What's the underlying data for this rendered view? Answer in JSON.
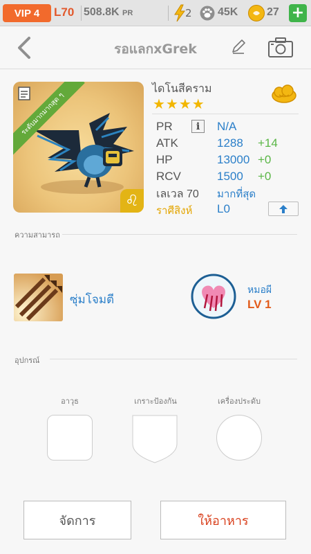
{
  "topbar": {
    "vip": "VIP 4",
    "level": "L70",
    "power": "508.8K",
    "power_unit": "PR",
    "energy": "2",
    "paw_count": "45K",
    "coins": "27",
    "add_label": "+"
  },
  "header": {
    "title": "รอแลกxGrek",
    "icons": [
      "back-chevron-icon",
      "edit-pencil-icon",
      "camera-icon"
    ]
  },
  "monster": {
    "name": "ไดโนสีคราม",
    "stars": "★★★★",
    "rarity_ribbon": "ระดับมากมากสุด ๆ",
    "zodiac_symbol": "♌",
    "stats": {
      "pr_label": "PR",
      "pr_value": "N/A",
      "atk_label": "ATK",
      "atk_value": "1288",
      "atk_bonus": "+14",
      "hp_label": "HP",
      "hp_value": "13000",
      "hp_bonus": "+0",
      "rcv_label": "RCV",
      "rcv_value": "1500",
      "rcv_bonus": "+0",
      "level_label": "เลเวล 70",
      "level_value": "มากที่สุด",
      "zodiac_label": "ราศีสิงห์",
      "zodiac_value": "L0"
    },
    "info_label": "i"
  },
  "abilities": {
    "section_title": "ความสามารถ",
    "skill_name": "ซุ่มโจมตี",
    "leader_name": "หมอผี",
    "leader_level": "LV 1"
  },
  "equipment": {
    "section_title": "อุปกรณ์",
    "slots": [
      "อาวุธ",
      "เกราะป้องกัน",
      "เครื่องประดับ"
    ]
  },
  "actions": {
    "manage": "จัดการ",
    "feed": "ให้อาหาร"
  },
  "colors": {
    "accent_blue": "#2b7fc9",
    "bonus_green": "#5ab646",
    "vip_orange": "#f26a2c",
    "level_orange": "#e25b1a",
    "star_gold": "#f2b600"
  }
}
